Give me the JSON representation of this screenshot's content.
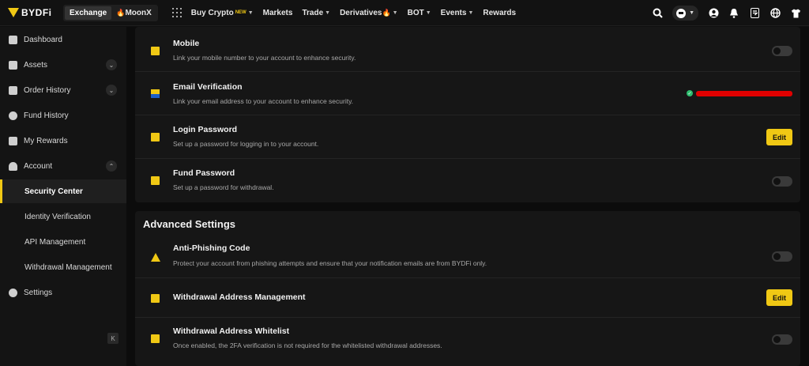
{
  "topbar": {
    "logo_text": "BYDFi",
    "modes": [
      "Exchange",
      "MoonX"
    ],
    "nav": [
      {
        "label": "Buy Crypto",
        "badge": "NEW",
        "caret": true
      },
      {
        "label": "Markets",
        "caret": false
      },
      {
        "label": "Trade",
        "caret": true
      },
      {
        "label": "Derivatives",
        "caret": true
      },
      {
        "label": "BOT",
        "caret": true
      },
      {
        "label": "Events",
        "caret": true
      },
      {
        "label": "Rewards",
        "caret": false
      }
    ]
  },
  "sidebar": {
    "items": [
      {
        "label": "Dashboard",
        "icon": "home-icon"
      },
      {
        "label": "Assets",
        "icon": "wallet-icon"
      },
      {
        "label": "Order History",
        "icon": "document-icon"
      },
      {
        "label": "Fund History",
        "icon": "history-icon"
      },
      {
        "label": "My Rewards",
        "icon": "gift-icon"
      },
      {
        "label": "Account",
        "icon": "user-icon"
      },
      {
        "label": "Security Center"
      },
      {
        "label": "Identity Verification"
      },
      {
        "label": "API Management"
      },
      {
        "label": "Withdrawal Management"
      },
      {
        "label": "Settings",
        "icon": "gear-icon"
      }
    ]
  },
  "security": {
    "rows": [
      {
        "title": "Mobile",
        "desc": "Link your mobile number to your account to enhance security.",
        "icon": "mobile-icon",
        "action": "toggle"
      },
      {
        "title": "Email Verification",
        "desc": "Link your email address to your account to enhance security.",
        "icon": "mail-icon",
        "action": "verified"
      },
      {
        "title": "Login Password",
        "desc": "Set up a password for logging in to your account.",
        "icon": "lock-icon",
        "action": "edit"
      },
      {
        "title": "Fund Password",
        "desc": "Set up a password for withdrawal.",
        "icon": "key-icon",
        "action": "toggle"
      }
    ]
  },
  "advanced": {
    "title": "Advanced Settings",
    "rows": [
      {
        "title": "Anti-Phishing Code",
        "desc": "Protect your account from phishing attempts and ensure that your notification emails are from BYDFi only.",
        "icon": "warning-icon",
        "action": "toggle"
      },
      {
        "title": "Withdrawal Address Management",
        "desc": "",
        "icon": "address-book-icon",
        "action": "edit"
      },
      {
        "title": "Withdrawal Address Whitelist",
        "desc": "Once enabled, the 2FA verification is not required for the whitelisted withdrawal addresses.",
        "icon": "whitelist-icon",
        "action": "toggle"
      }
    ]
  },
  "labels": {
    "edit": "Edit"
  },
  "colors": {
    "accent": "#f0c814",
    "verified": "#2dbd6e",
    "redaction": "#e00000"
  }
}
